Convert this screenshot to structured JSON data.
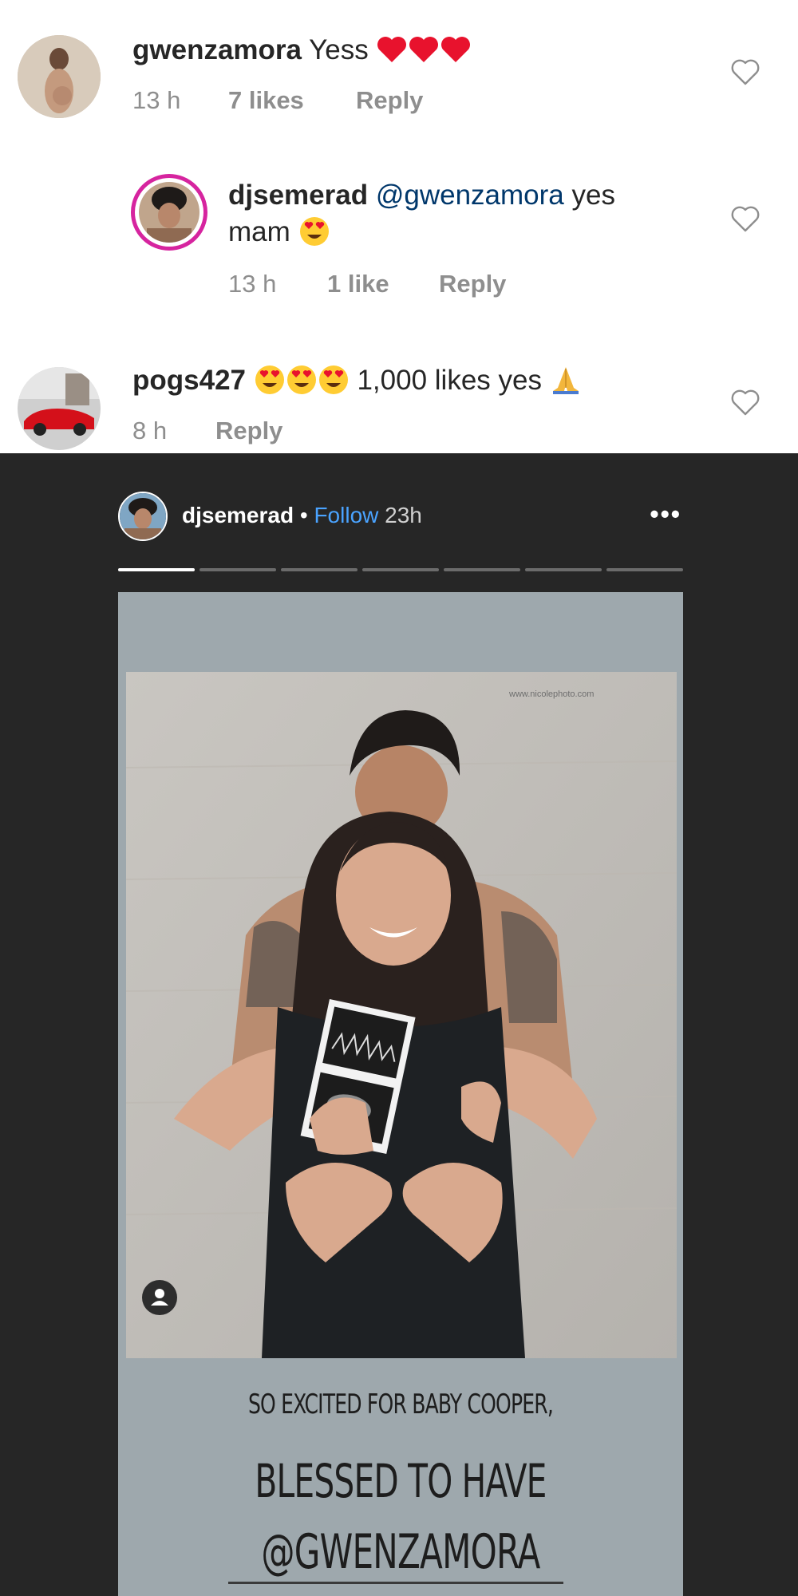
{
  "comments": [
    {
      "username": "gwenzamora",
      "text": "Yess",
      "time": "13 h",
      "likes": "7 likes",
      "reply": "Reply"
    },
    {
      "username": "djsemerad",
      "mention": "@gwenzamora",
      "text_line1": "yes",
      "text_line2": "mam",
      "time": "13 h",
      "likes": "1 like",
      "reply": "Reply"
    },
    {
      "username": "pogs427",
      "text": "1,000 likes yes",
      "time": "8 h",
      "reply": "Reply"
    }
  ],
  "story": {
    "username": "djsemerad",
    "separator": "•",
    "follow": "Follow",
    "time": "23h",
    "more": "•••",
    "segments": 7,
    "active_segment": 1,
    "watermark": "www.nicolephoto.com",
    "caption_line1": "SO EXCITED FOR BABY COOPER,",
    "caption_line2": "BLESSED TO HAVE",
    "caption_line3": "@GWENZAMORA"
  },
  "colors": {
    "like_heart": "#e0245e",
    "mention": "#00376b",
    "meta_grey": "#8e8e8e",
    "story_bg": "#262626",
    "follow_blue": "#4aa3ff",
    "story_card": "#9ea8ad"
  },
  "icons": [
    "heart-outline-icon",
    "red-heart-emoji-icon",
    "heart-eyes-emoji-icon",
    "folded-hands-emoji-icon",
    "more-dots-icon",
    "profile-icon"
  ]
}
